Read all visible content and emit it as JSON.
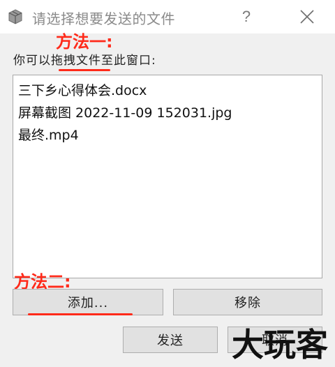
{
  "window": {
    "title": "请选择想要发送的文件",
    "help_label": "?"
  },
  "annotations": {
    "method1": "方法一:",
    "method2": "方法二:"
  },
  "instruction": "你可以拖拽文件至此窗口:",
  "files": [
    "三下乡心得体会.docx",
    "屏幕截图 2022-11-09 152031.jpg",
    "最终.mp4"
  ],
  "buttons": {
    "add": "添加...",
    "remove": "移除",
    "send": "发送",
    "cancel": "取消"
  },
  "watermark": "大玩客",
  "colors": {
    "annotation": "#ff2a1a",
    "window_bg": "#f0f0f0",
    "button_bg": "#e1e1e1"
  }
}
